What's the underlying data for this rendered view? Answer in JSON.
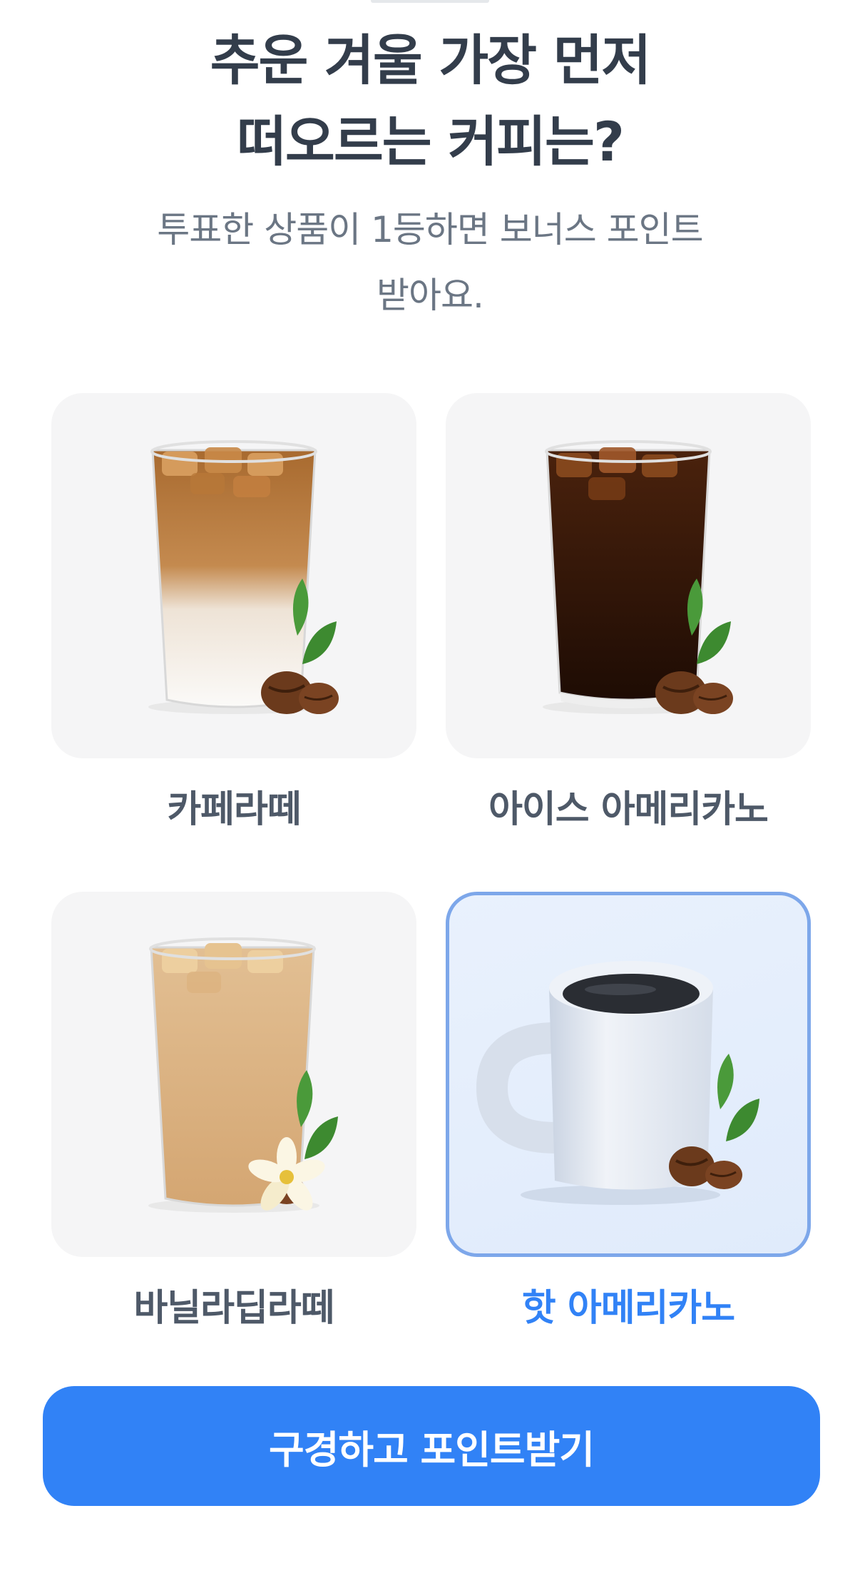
{
  "header": {
    "title_line1": "추운 겨울 가장 먼저",
    "title_line2": "떠오르는 커피는?",
    "subtitle_line1": "투표한 상품이 1등하면 보너스 포인트",
    "subtitle_line2": "받아요."
  },
  "options": [
    {
      "label": "카페라떼",
      "icon": "iced-latte-icon",
      "selected": false
    },
    {
      "label": "아이스 아메리카노",
      "icon": "iced-americano-icon",
      "selected": false
    },
    {
      "label": "바닐라딥라떼",
      "icon": "vanilla-latte-icon",
      "selected": false
    },
    {
      "label": "핫 아메리카노",
      "icon": "hot-coffee-mug-icon",
      "selected": true
    }
  ],
  "cta": {
    "label": "구경하고 포인트받기"
  },
  "colors": {
    "accent": "#3182f6",
    "title": "#333d4b",
    "subtitle": "#6b7684",
    "label": "#4e5968",
    "card_bg": "#f5f5f6",
    "selected_border": "#7da7ea"
  }
}
